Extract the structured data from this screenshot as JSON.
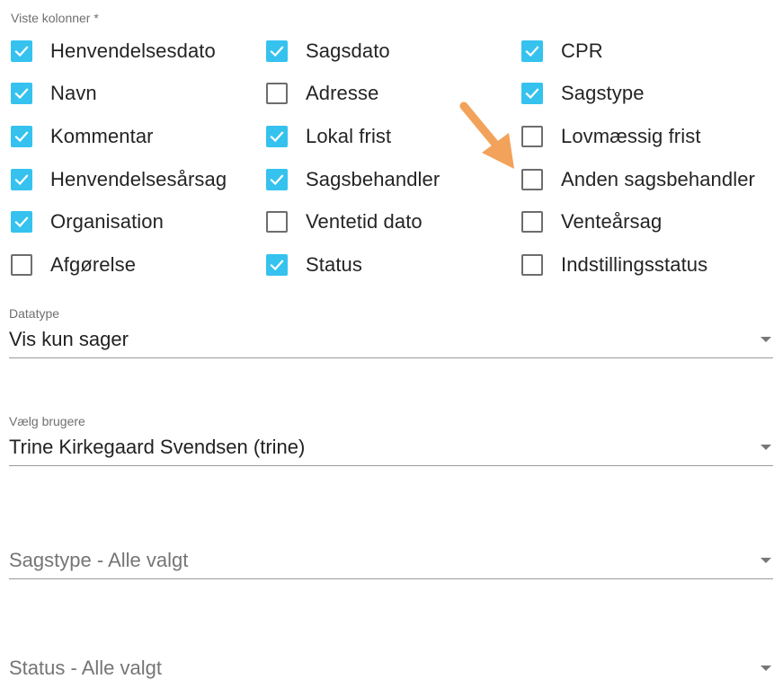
{
  "columns_section": {
    "label": "Viste kolonner *",
    "rows": [
      [
        {
          "label": "Henvendelsesdato",
          "checked": true
        },
        {
          "label": "Sagsdato",
          "checked": true
        },
        {
          "label": "CPR",
          "checked": true
        }
      ],
      [
        {
          "label": "Navn",
          "checked": true
        },
        {
          "label": "Adresse",
          "checked": false
        },
        {
          "label": "Sagstype",
          "checked": true
        }
      ],
      [
        {
          "label": "Kommentar",
          "checked": true
        },
        {
          "label": "Lokal frist",
          "checked": true
        },
        {
          "label": "Lovmæssig frist",
          "checked": false
        }
      ],
      [
        {
          "label": "Henvendelsesårsag",
          "checked": true
        },
        {
          "label": "Sagsbehandler",
          "checked": true
        },
        {
          "label": "Anden sagsbehandler",
          "checked": false
        }
      ],
      [
        {
          "label": "Organisation",
          "checked": true
        },
        {
          "label": "Ventetid dato",
          "checked": false
        },
        {
          "label": "Venteårsag",
          "checked": false
        }
      ],
      [
        {
          "label": "Afgørelse",
          "checked": false
        },
        {
          "label": "Status",
          "checked": true
        },
        {
          "label": "Indstillingsstatus",
          "checked": false
        }
      ]
    ]
  },
  "datatype": {
    "label": "Datatype",
    "value": "Vis kun sager"
  },
  "users": {
    "label": "Vælg brugere",
    "value": "Trine Kirkegaard Svendsen (trine)"
  },
  "sagstype": {
    "placeholder": "Sagstype - Alle valgt"
  },
  "status": {
    "placeholder": "Status - Alle valgt"
  },
  "colors": {
    "checkbox_checked": "#35c2ee",
    "checkbox_border": "#6d6d6d",
    "annotation_arrow": "#f2a25a"
  },
  "icons": {
    "checked": "checkmark-icon",
    "dropdown": "caret-down-icon",
    "annotation": "annotation-arrow-icon"
  }
}
